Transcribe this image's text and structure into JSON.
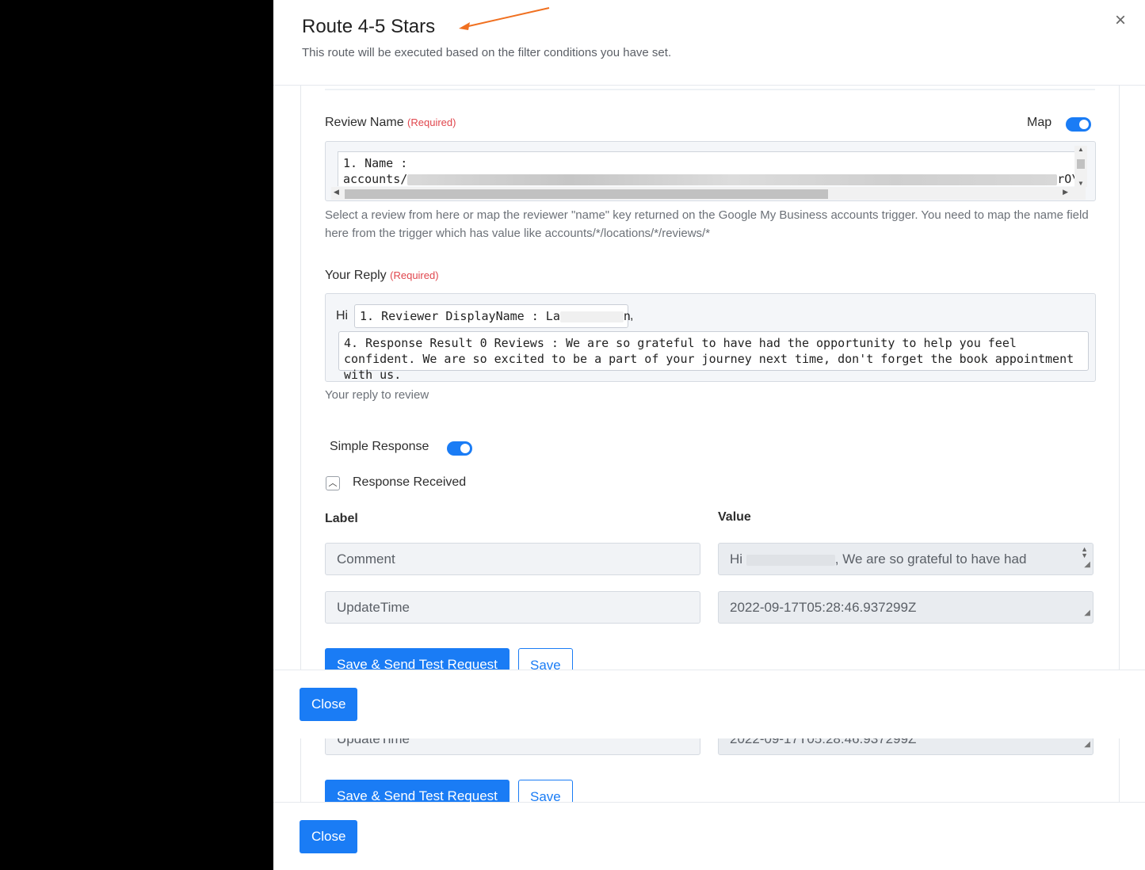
{
  "modal": {
    "title": "Route 4-5 Stars",
    "subtitle": "This route will be executed based on the filter conditions you have set.",
    "close_symbol": "×"
  },
  "review_name": {
    "label": "Review Name",
    "required": "(Required)",
    "map_label": "Map",
    "line1": "1. Name :",
    "line2_prefix": "accounts/",
    "line2_suffix": "rO\\",
    "help": "Select a review from here or map the reviewer \"name\" key returned on the Google My Business accounts trigger. You need to map the name field here from the trigger which has value like accounts/*/locations/*/reviews/*"
  },
  "your_reply": {
    "label": "Your Reply",
    "required": "(Required)",
    "hi": "Hi",
    "pill1": "1. Reviewer DisplayName : La",
    "pill1_tail": "n",
    "comma": ",",
    "pill2": "4. Response Result 0 Reviews : We are so grateful to have had the opportunity to help you feel confident. We are so excited to be a part of your journey next time, don't forget the book appointment with us.",
    "help": "Your reply to review"
  },
  "simple_response": {
    "label": "Simple Response"
  },
  "response_received": {
    "label": "Response Received",
    "col_label": "Label",
    "col_value": "Value",
    "rows": [
      {
        "label": "Comment",
        "value_prefix": "Hi",
        "value_rest": ", We are so grateful to have had"
      },
      {
        "label": "UpdateTime",
        "value": "2022-09-17T05:28:46.937299Z"
      }
    ]
  },
  "buttons": {
    "save_send": "Save & Send Test Request",
    "save": "Save",
    "close": "Close"
  },
  "colors": {
    "accent": "#1a7cf5",
    "required": "#e0464d",
    "arrow": "#f07020"
  }
}
